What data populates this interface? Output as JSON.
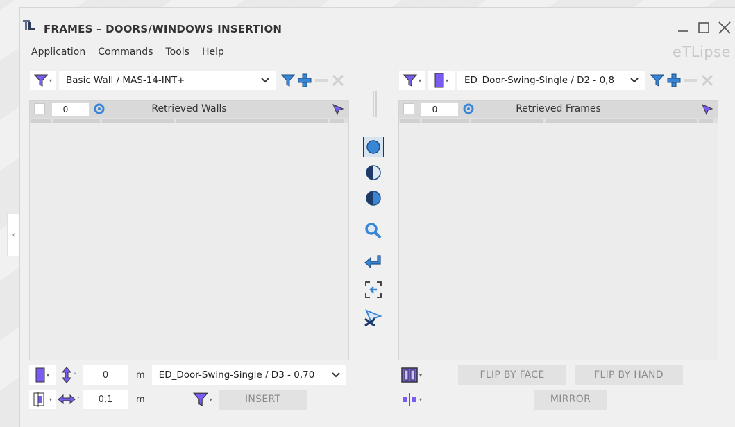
{
  "window": {
    "title": "FRAMES – DOORS/WINDOWS INSERTION",
    "brand": "eTLipse"
  },
  "menu": {
    "items": [
      "Application",
      "Commands",
      "Tools",
      "Help"
    ]
  },
  "left": {
    "filter_value": "Basic Wall / MAS-14-INT+",
    "count": "0",
    "panel_title": "Retrieved Walls"
  },
  "right": {
    "filter_value": "ED_Door-Swing-Single / D2 - 0,8",
    "count": "0",
    "panel_title": "Retrieved Frames"
  },
  "bottom_left": {
    "offset_value": "0",
    "offset_unit": "m",
    "type_value": "ED_Door-Swing-Single / D3 - 0,70",
    "spacing_value": "0,1",
    "spacing_unit": "m",
    "insert_label": "INSERT"
  },
  "bottom_right": {
    "flip_face_label": "FLIP BY FACE",
    "flip_hand_label": "FLIP BY HAND",
    "mirror_label": "MIRROR"
  },
  "side_tab": {
    "glyph": "‹"
  },
  "colors": {
    "accent_blue": "#3a86d6",
    "filter_purple": "#7b5cf2",
    "arrow_green": "#7dbf4a",
    "panel_header": "#d9d9d9"
  }
}
